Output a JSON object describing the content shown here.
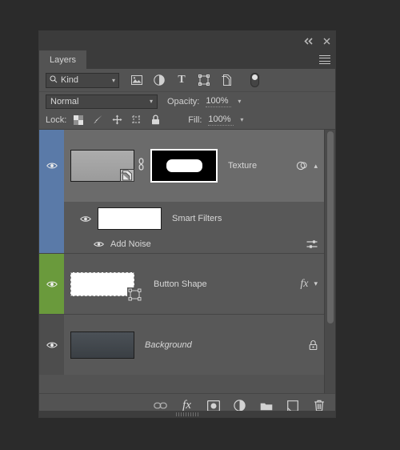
{
  "window": {
    "collapse_icon": "collapse-arrows-icon",
    "close_icon": "close-icon",
    "menu_icon": "panel-menu-icon"
  },
  "tabs": [
    {
      "label": "Layers",
      "active": true
    }
  ],
  "filter": {
    "kind_label": "Kind",
    "search_icon": "search-icon",
    "icons": [
      {
        "name": "filter-pixel-icon",
        "glyph": "⛰"
      },
      {
        "name": "filter-adjustment-icon",
        "glyph": "◑"
      },
      {
        "name": "filter-type-icon",
        "glyph": "T"
      },
      {
        "name": "filter-shape-icon",
        "glyph": "⬚"
      },
      {
        "name": "filter-smart-object-icon",
        "glyph": "❐"
      }
    ],
    "toggle_name": "filter-enable-toggle"
  },
  "blend": {
    "mode": "Normal",
    "opacity_label": "Opacity:",
    "opacity_value": "100%"
  },
  "lock": {
    "label": "Lock:",
    "icons": [
      {
        "name": "lock-transparent-pixels-icon"
      },
      {
        "name": "lock-image-pixels-icon"
      },
      {
        "name": "lock-position-icon"
      },
      {
        "name": "lock-artboard-nesting-icon"
      },
      {
        "name": "lock-all-icon"
      }
    ],
    "fill_label": "Fill:",
    "fill_value": "100%"
  },
  "layers": [
    {
      "name": "Texture",
      "color_label": "#5a7aa8",
      "selected": true,
      "visible": true,
      "italic": false,
      "has_mask": true,
      "has_link": true,
      "smart_object_badge": true,
      "right_icons": [
        "smart-filters-icon",
        "chevron-up-icon"
      ]
    },
    {
      "name": "Smart Filters",
      "color_label": "#5a7aa8",
      "selected": false,
      "visible": true,
      "italic": false,
      "is_smart_filter_header": true,
      "right_icons": []
    },
    {
      "name": "Add Noise",
      "color_label": "#5a7aa8",
      "selected": false,
      "visible": true,
      "is_filter_entry": true,
      "right_icons": [
        "filter-options-icon"
      ]
    },
    {
      "name": "Button Shape",
      "color_label": "#6a9a3c",
      "selected": false,
      "visible": true,
      "italic": false,
      "vector_badge": true,
      "right_icons": [
        "fx-icon",
        "chevron-down-icon"
      ]
    },
    {
      "name": "Background",
      "color_label": "#4d4d4d",
      "selected": false,
      "visible": true,
      "italic": true,
      "right_icons": [
        "lock-icon"
      ]
    }
  ],
  "toolbar": {
    "buttons": [
      {
        "name": "link-layers-button",
        "glyph": "⚭"
      },
      {
        "name": "add-layer-style-button",
        "glyph": "fx"
      },
      {
        "name": "add-layer-mask-button",
        "glyph": "▣"
      },
      {
        "name": "new-adjustment-layer-button",
        "glyph": "◑"
      },
      {
        "name": "new-group-button",
        "glyph": "▰"
      },
      {
        "name": "new-layer-button",
        "glyph": "□"
      },
      {
        "name": "delete-layer-button",
        "glyph": "Ὕ1"
      }
    ]
  },
  "colors": {
    "panel_bg": "#535353",
    "header_bg": "#3b3b3b",
    "selected_row": "#6b6b6b",
    "row_bg": "#585858",
    "text": "#d7d7d7",
    "blue_label": "#5a7aa8",
    "green_label": "#6a9a3c"
  }
}
